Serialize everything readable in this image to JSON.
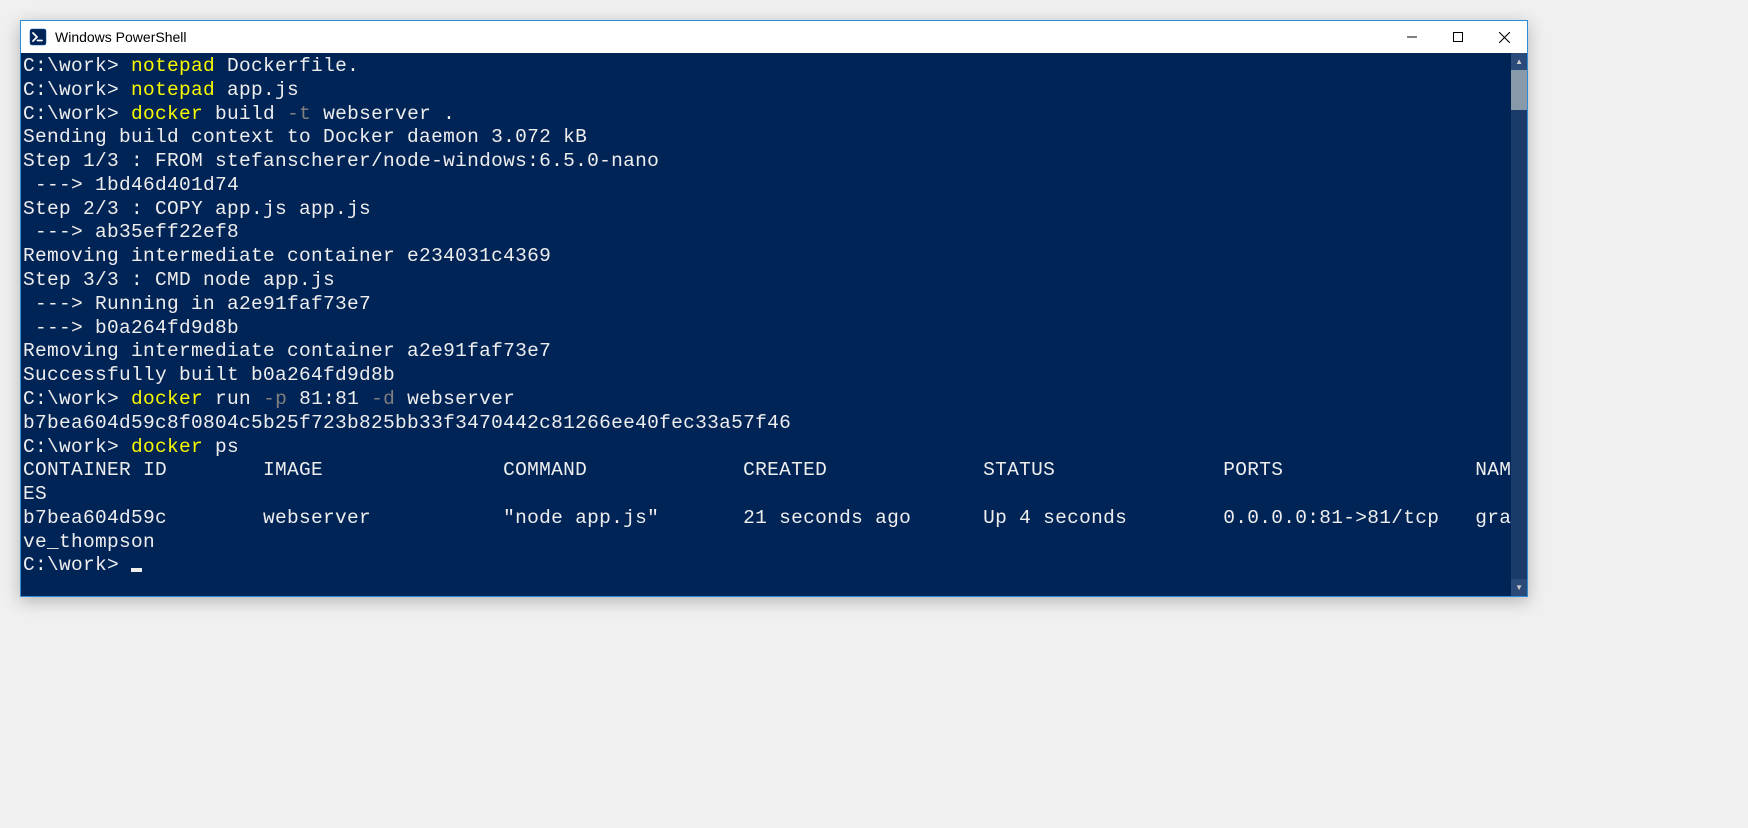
{
  "window": {
    "title": "Windows PowerShell"
  },
  "colors": {
    "bg": "#012456",
    "fg": "#eeeeee",
    "yellow": "#f9f900",
    "gray": "#808080",
    "border": "#2e8bd4"
  },
  "prompt": "C:\\work> ",
  "lines": [
    {
      "type": "cmd",
      "segments": [
        {
          "cls": "c-white",
          "t": "C:\\work> "
        },
        {
          "cls": "c-yellow",
          "t": "notepad"
        },
        {
          "cls": "c-white",
          "t": " Dockerfile."
        }
      ]
    },
    {
      "type": "cmd",
      "segments": [
        {
          "cls": "c-white",
          "t": "C:\\work> "
        },
        {
          "cls": "c-yellow",
          "t": "notepad"
        },
        {
          "cls": "c-white",
          "t": " app.js"
        }
      ]
    },
    {
      "type": "cmd",
      "segments": [
        {
          "cls": "c-white",
          "t": "C:\\work> "
        },
        {
          "cls": "c-yellow",
          "t": "docker"
        },
        {
          "cls": "c-white",
          "t": " build "
        },
        {
          "cls": "c-gray",
          "t": "-t"
        },
        {
          "cls": "c-white",
          "t": " webserver ."
        }
      ]
    },
    {
      "type": "out",
      "segments": [
        {
          "cls": "c-white",
          "t": "Sending build context to Docker daemon 3.072 kB"
        }
      ]
    },
    {
      "type": "out",
      "segments": [
        {
          "cls": "c-white",
          "t": "Step 1/3 : FROM stefanscherer/node-windows:6.5.0-nano"
        }
      ]
    },
    {
      "type": "out",
      "segments": [
        {
          "cls": "c-white",
          "t": " ---> 1bd46d401d74"
        }
      ]
    },
    {
      "type": "out",
      "segments": [
        {
          "cls": "c-white",
          "t": "Step 2/3 : COPY app.js app.js"
        }
      ]
    },
    {
      "type": "out",
      "segments": [
        {
          "cls": "c-white",
          "t": " ---> ab35eff22ef8"
        }
      ]
    },
    {
      "type": "out",
      "segments": [
        {
          "cls": "c-white",
          "t": "Removing intermediate container e234031c4369"
        }
      ]
    },
    {
      "type": "out",
      "segments": [
        {
          "cls": "c-white",
          "t": "Step 3/3 : CMD node app.js"
        }
      ]
    },
    {
      "type": "out",
      "segments": [
        {
          "cls": "c-white",
          "t": " ---> Running in a2e91faf73e7"
        }
      ]
    },
    {
      "type": "out",
      "segments": [
        {
          "cls": "c-white",
          "t": " ---> b0a264fd9d8b"
        }
      ]
    },
    {
      "type": "out",
      "segments": [
        {
          "cls": "c-white",
          "t": "Removing intermediate container a2e91faf73e7"
        }
      ]
    },
    {
      "type": "out",
      "segments": [
        {
          "cls": "c-white",
          "t": "Successfully built b0a264fd9d8b"
        }
      ]
    },
    {
      "type": "cmd",
      "segments": [
        {
          "cls": "c-white",
          "t": "C:\\work> "
        },
        {
          "cls": "c-yellow",
          "t": "docker"
        },
        {
          "cls": "c-white",
          "t": " run "
        },
        {
          "cls": "c-gray",
          "t": "-p"
        },
        {
          "cls": "c-white",
          "t": " 81:81 "
        },
        {
          "cls": "c-gray",
          "t": "-d"
        },
        {
          "cls": "c-white",
          "t": " webserver"
        }
      ]
    },
    {
      "type": "out",
      "segments": [
        {
          "cls": "c-white",
          "t": "b7bea604d59c8f0804c5b25f723b825bb33f3470442c81266ee40fec33a57f46"
        }
      ]
    },
    {
      "type": "cmd",
      "segments": [
        {
          "cls": "c-white",
          "t": "C:\\work> "
        },
        {
          "cls": "c-yellow",
          "t": "docker"
        },
        {
          "cls": "c-white",
          "t": " ps"
        }
      ]
    },
    {
      "type": "out",
      "segments": [
        {
          "cls": "c-white",
          "t": "CONTAINER ID        IMAGE               COMMAND             CREATED             STATUS              PORTS                NAMES"
        }
      ]
    },
    {
      "type": "out",
      "segments": [
        {
          "cls": "c-white",
          "t": "b7bea604d59c        webserver           \"node app.js\"       21 seconds ago      Up 4 seconds        0.0.0.0:81->81/tcp   grave_thompson"
        }
      ]
    },
    {
      "type": "cmd",
      "segments": [
        {
          "cls": "c-white",
          "t": "C:\\work> "
        }
      ],
      "cursor": true
    }
  ],
  "docker_ps": {
    "headers": [
      "CONTAINER ID",
      "IMAGE",
      "COMMAND",
      "CREATED",
      "STATUS",
      "PORTS",
      "NAMES"
    ],
    "rows": [
      {
        "container_id": "b7bea604d59c",
        "image": "webserver",
        "command": "\"node app.js\"",
        "created": "21 seconds ago",
        "status": "Up 4 seconds",
        "ports": "0.0.0.0:81->81/tcp",
        "names": "grave_thompson"
      }
    ]
  }
}
